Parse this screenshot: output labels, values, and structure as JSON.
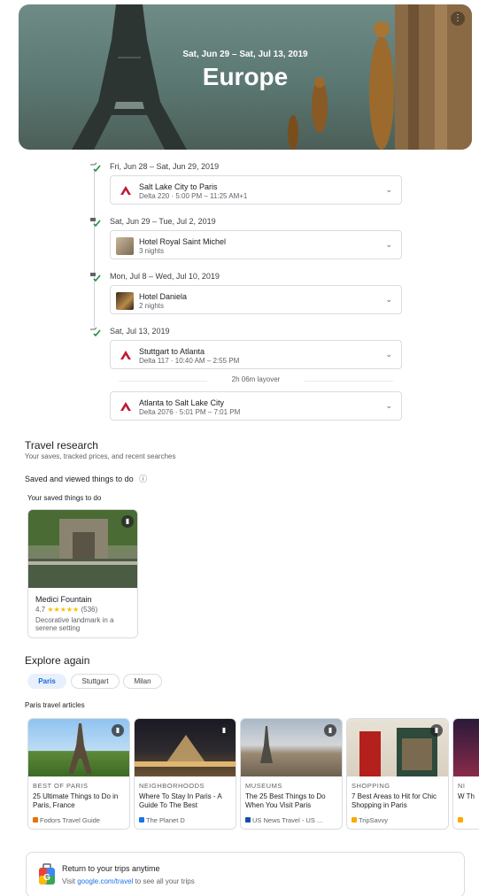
{
  "hero": {
    "dates": "Sat, Jun 29 – Sat, Jul 13, 2019",
    "title": "Europe",
    "menu_icon": "⋮"
  },
  "timeline": [
    {
      "date": "Fri, Jun 28 – Sat, Jun 29, 2019",
      "icon": "flight-check-icon",
      "cards": [
        {
          "type": "flight",
          "title": "Salt Lake City to Paris",
          "detail": "Delta 220 · 5:00 PM – 11:25 AM+1"
        }
      ]
    },
    {
      "date": "Sat, Jun 29 – Tue, Jul 2, 2019",
      "icon": "hotel-check-icon",
      "cards": [
        {
          "type": "hotel",
          "title": "Hotel Royal Saint Michel",
          "detail": "3 nights"
        }
      ]
    },
    {
      "date": "Mon, Jul 8 – Wed, Jul 10, 2019",
      "icon": "hotel-check-icon",
      "cards": [
        {
          "type": "hotel",
          "title": "Hotel Daniela",
          "detail": "2 nights"
        }
      ]
    },
    {
      "date": "Sat, Jul 13, 2019",
      "icon": "flight-check-icon",
      "cards": [
        {
          "type": "flight",
          "title": "Stuttgart to Atlanta",
          "detail": "Delta 117 · 10:40 AM – 2:55 PM"
        },
        {
          "type": "flight",
          "title": "Atlanta to Salt Lake City",
          "detail": "Delta 2076 · 5:01 PM – 7:01 PM"
        }
      ],
      "layover": "2h 06m layover"
    }
  ],
  "research": {
    "title": "Travel research",
    "subtitle": "Your saves, tracked prices, and recent searches",
    "saved_header": "Saved and viewed things to do",
    "saved_label": "Your saved things to do",
    "saved_item": {
      "name": "Medici Fountain",
      "rating": "4.7",
      "stars": "★★★★★",
      "count": "(536)",
      "desc": "Decorative landmark in a serene setting"
    }
  },
  "explore": {
    "title": "Explore again",
    "chips": [
      "Paris",
      "Stuttgart",
      "Milan"
    ],
    "articles_label": "Paris travel articles",
    "articles": [
      {
        "category": "BEST OF PARIS",
        "title": "25 Ultimate Things to Do in Paris, France",
        "source": "Fodors Travel Guide",
        "color": "#e8710a"
      },
      {
        "category": "NEIGHBORHOODS",
        "title": "Where To Stay In Paris - A Guide To The Best",
        "source": "The Planet D",
        "color": "#1a73e8"
      },
      {
        "category": "MUSEUMS",
        "title": "The 25 Best Things to Do When You Visit Paris",
        "source": "US News Travel - US ...",
        "color": "#174ea6"
      },
      {
        "category": "SHOPPING",
        "title": "7 Best Areas to Hit for Chic Shopping in Paris",
        "source": "TripSavvy",
        "color": "#f9ab00"
      },
      {
        "category": "NI",
        "title": "W Th",
        "source": "",
        "color": "#f9ab00"
      }
    ]
  },
  "return_banner": {
    "title": "Return to your trips anytime",
    "text_before": "Visit ",
    "link": "google.com/travel",
    "text_after": " to see all your trips"
  }
}
